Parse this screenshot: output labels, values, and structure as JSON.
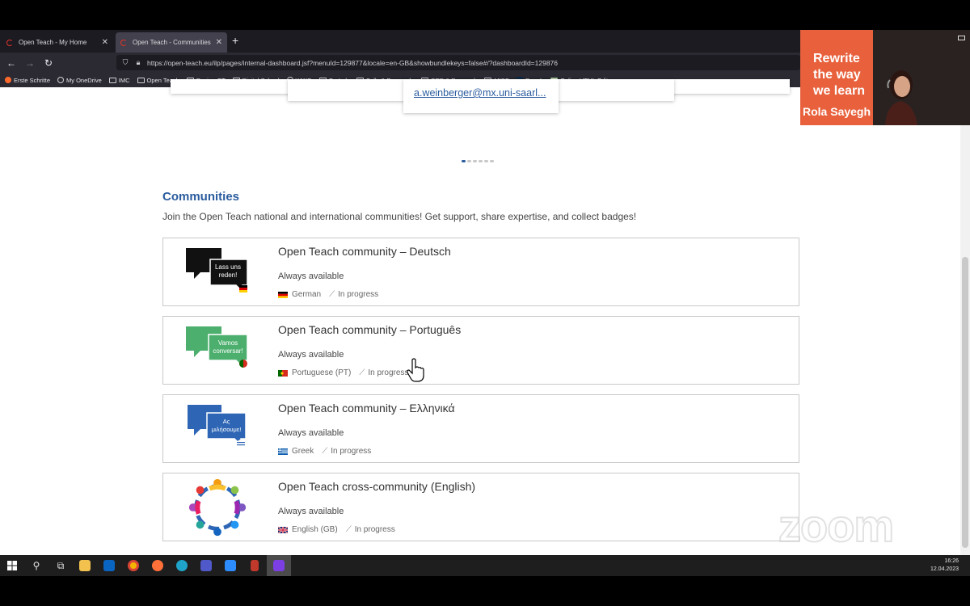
{
  "browser": {
    "tabs": [
      {
        "label": "Open Teach - My Home"
      },
      {
        "label": "Open Teach - Communities"
      }
    ],
    "url": "https://open-teach.eu/ilp/pages/internal-dashboard.jsf?menuId=129877&locale=en-GB&showbundlekeys=false#/?dashboardId=129876",
    "bookmarks": [
      {
        "label": "Erste Schritte",
        "icon": "firefox-icon"
      },
      {
        "label": "My OneDrive",
        "icon": "globe-icon"
      },
      {
        "label": "IMC",
        "icon": "folder-icon"
      },
      {
        "label": "Open Teach",
        "icon": "folder-icon"
      },
      {
        "label": "Design-CT",
        "icon": "folder-icon"
      },
      {
        "label": "Digital School",
        "icon": "folder-icon"
      },
      {
        "label": "WWG",
        "icon": "globe-icon"
      },
      {
        "label": "Go-Lab",
        "icon": "folder-icon"
      },
      {
        "label": "Calls & Proposals",
        "icon": "folder-icon"
      },
      {
        "label": "OER & Research",
        "icon": "folder-icon"
      },
      {
        "label": "MISC",
        "icon": "folder-icon"
      },
      {
        "label": "DeepL",
        "icon": "deepl-icon"
      },
      {
        "label": "Online HTML Editor - ...",
        "icon": "html-editor-icon"
      }
    ]
  },
  "carousel": {
    "email": "a.weinberger@mx.uni-saarl..."
  },
  "communities": {
    "title": "Communities",
    "description": "Join the Open Teach national and international communities! Get support, share expertise, and collect badges!",
    "items": [
      {
        "title": "Open Teach community – Deutsch",
        "availability": "Always available",
        "language": "German",
        "status": "In progress",
        "bubble_text": "Lass uns reden!",
        "color": "#111111"
      },
      {
        "title": "Open Teach community – Português",
        "availability": "Always available",
        "language": "Portuguese (PT)",
        "status": "In progress",
        "bubble_text": "Vamos conversar!",
        "color": "#4caf6e"
      },
      {
        "title": "Open Teach community – Ελληνικά",
        "availability": "Always available",
        "language": "Greek",
        "status": "In progress",
        "bubble_text": "Ας μιλήσουμε!",
        "color": "#2e66b5"
      },
      {
        "title": "Open Teach cross-community (English)",
        "availability": "Always available",
        "language": "English (GB)",
        "status": "In progress"
      }
    ]
  },
  "video": {
    "slogan_line1": "Rewrite",
    "slogan_line2": "the way",
    "slogan_line3": "we learn",
    "participant": "Rola Sayegh"
  },
  "watermark": "zoom",
  "taskbar": {
    "time": "16:26",
    "date": "12.04.2023"
  }
}
